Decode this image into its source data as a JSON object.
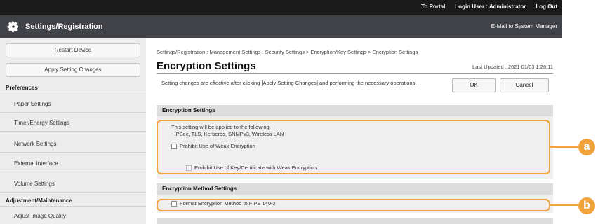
{
  "topbar": {
    "portal": "To Portal",
    "login_user": "Login User : Administrator",
    "logout": "Log Out"
  },
  "titlebar": {
    "title": "Settings/Registration",
    "mail": "E-Mail to System Manager",
    "icon": "gear-icon"
  },
  "sidebar": {
    "restart": "Restart Device",
    "apply": "Apply Setting Changes",
    "preferences_heading": "Preferences",
    "preferences_items": [
      "Paper Settings",
      "Timer/Energy Settings",
      "Network Settings",
      "External Interface",
      "Volume Settings"
    ],
    "adjust_heading": "Adjustment/Maintenance",
    "adjust_items": [
      "Adjust Image Quality"
    ]
  },
  "main": {
    "breadcrumb": "Settings/Registration : Management Settings : Security Settings > Encryption/Key Settings > Encryption Settings",
    "title": "Encryption Settings",
    "updated": "Last Updated : 2021 01/03 1:26:11",
    "description": "Setting changes are effective after clicking [Apply Setting Changes] and performing the necessary operations.",
    "ok": "OK",
    "cancel": "Cancel",
    "encryption_section": {
      "heading": "Encryption Settings",
      "note_line1": "This setting will be applied to the following.",
      "note_line2": "- IPSec, TLS, Kerberos, SNMPv3, Wireless LAN",
      "prohibit_weak": "Prohibit Use of Weak Encryption",
      "prohibit_weak_checked": false,
      "prohibit_key_cert": "Prohibit Use of Key/Certificate with Weak Encryption",
      "prohibit_key_cert_checked": false,
      "prohibit_key_cert_enabled": false
    },
    "method_section": {
      "heading": "Encryption Method Settings",
      "fips": "Format Encryption Method to FIPS 140-2",
      "fips_checked": false
    }
  },
  "callouts": {
    "a": "a",
    "b": "b",
    "color": "#f0a23b"
  }
}
